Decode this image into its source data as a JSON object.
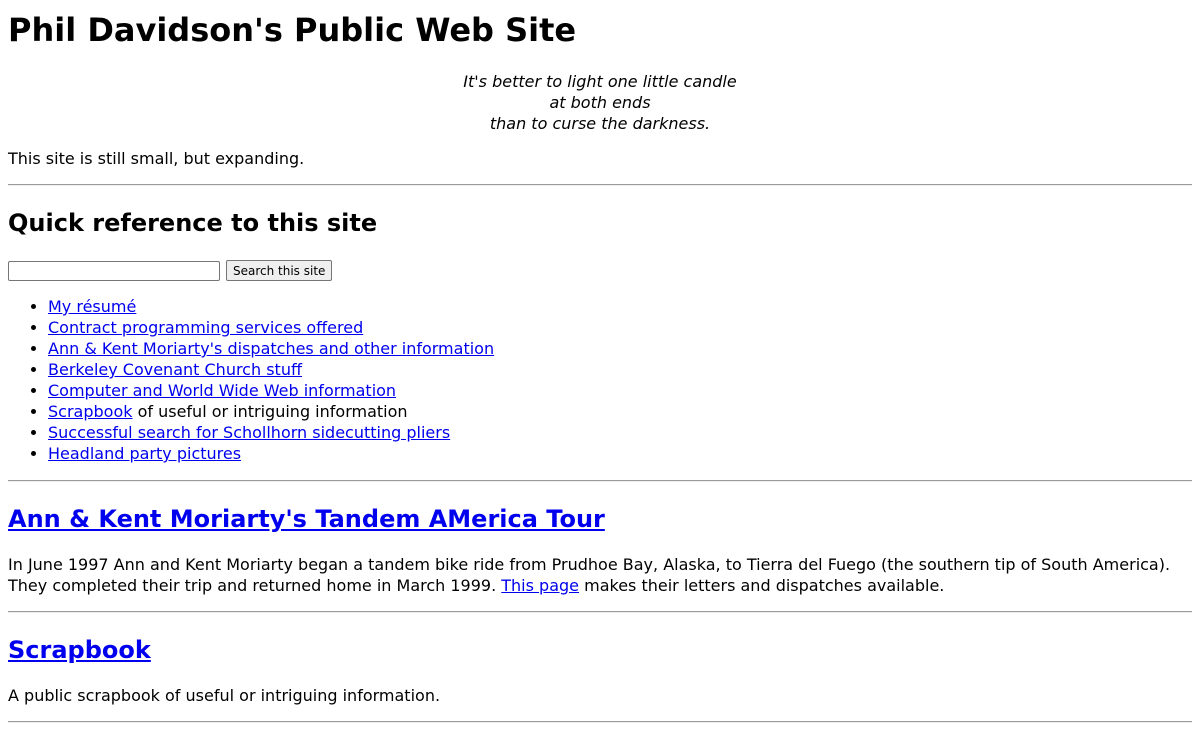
{
  "header": {
    "title": "Phil Davidson's Public Web Site",
    "quote_lines": [
      "It's better to light one little candle",
      "at both ends",
      "than to curse the darkness."
    ],
    "intro": "This site is still small, but expanding."
  },
  "quickref": {
    "heading": "Quick reference to this site",
    "search": {
      "value": "",
      "placeholder": "",
      "button_label": "Search this site"
    },
    "links": [
      {
        "link_text": "My résumé",
        "suffix": ""
      },
      {
        "link_text": "Contract programming services offered",
        "suffix": ""
      },
      {
        "link_text": "Ann & Kent Moriarty's dispatches and other information",
        "suffix": ""
      },
      {
        "link_text": "Berkeley Covenant Church stuff",
        "suffix": ""
      },
      {
        "link_text": "Computer and World Wide Web information",
        "suffix": ""
      },
      {
        "link_text": "Scrapbook",
        "suffix": " of useful or intriguing information"
      },
      {
        "link_text": "Successful search for Schollhorn sidecutting pliers",
        "suffix": ""
      },
      {
        "link_text": "Headland party pictures",
        "suffix": ""
      }
    ]
  },
  "tour": {
    "heading": "Ann & Kent Moriarty's Tandem AMerica Tour",
    "text_before": "In June 1997 Ann and Kent Moriarty began a tandem bike ride from Prudhoe Bay, Alaska, to Tierra del Fuego (the southern tip of South America). They completed their trip and returned home in March 1999. ",
    "link_text": "This page",
    "text_after": " makes their letters and dispatches available."
  },
  "scrapbook": {
    "heading": "Scrapbook",
    "text": "A public scrapbook of useful or intriguing information."
  },
  "colors": {
    "link": "#0000ee",
    "rule": "#9a9a9a"
  }
}
